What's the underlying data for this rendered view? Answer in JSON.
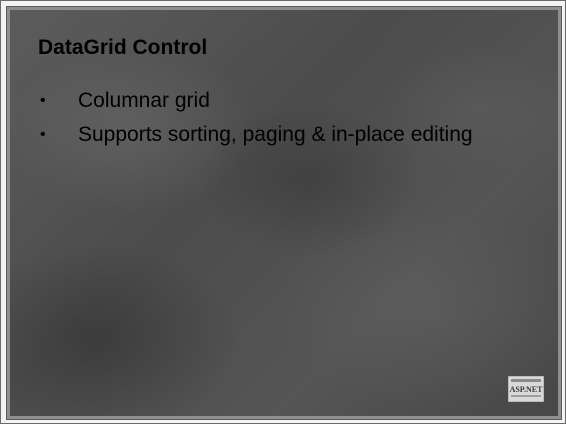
{
  "slide": {
    "title": "DataGrid Control",
    "bullets": [
      "Columnar grid",
      "Supports sorting, paging & in-place editing"
    ],
    "bullet_glyph": "•",
    "logo": {
      "icon": "aspnet-logo-icon",
      "text": "ASP.NET"
    }
  }
}
